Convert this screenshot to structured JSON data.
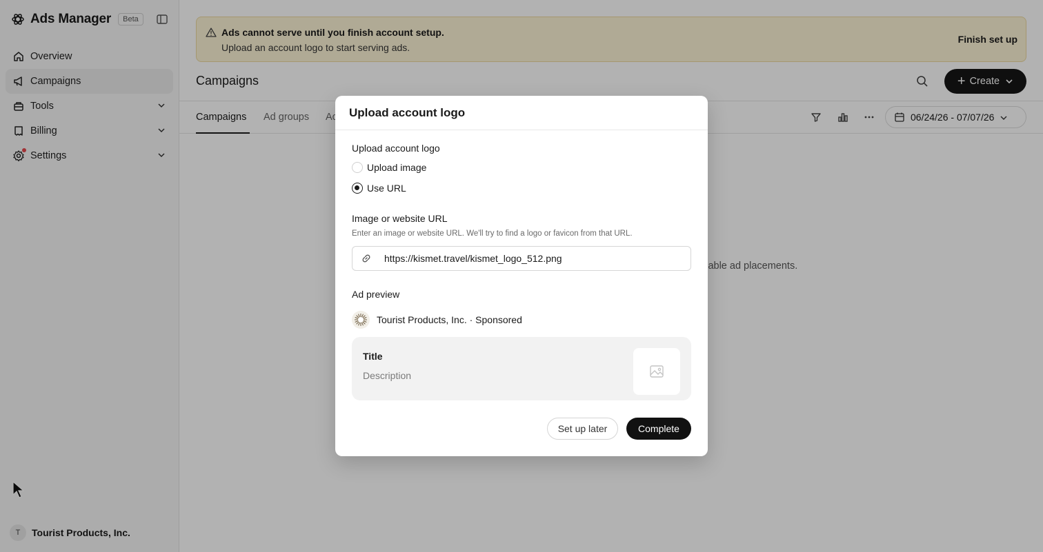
{
  "sidebar": {
    "app_title": "Ads Manager",
    "beta_label": "Beta",
    "items": [
      {
        "label": "Overview",
        "icon": "home-icon"
      },
      {
        "label": "Campaigns",
        "icon": "megaphone-icon",
        "active": true
      },
      {
        "label": "Tools",
        "icon": "tools-icon",
        "expandable": true
      },
      {
        "label": "Billing",
        "icon": "card-icon",
        "expandable": true
      },
      {
        "label": "Settings",
        "icon": "gear-icon",
        "expandable": true,
        "notification": true
      }
    ],
    "account": {
      "initial": "T",
      "name": "Tourist Products, Inc."
    }
  },
  "banner": {
    "title": "Ads cannot serve until you finish account setup.",
    "message": "Upload an account logo to start serving ads.",
    "action": "Finish set up"
  },
  "header": {
    "page_title": "Campaigns",
    "create_label": "Create"
  },
  "tabs": [
    {
      "label": "Campaigns",
      "active": true
    },
    {
      "label": "Ad groups"
    },
    {
      "label": "Ac"
    }
  ],
  "toolbar": {
    "date_range": "06/24/26 - 07/07/26"
  },
  "empty_state": {
    "text_fragment": "ilable ad placements."
  },
  "modal": {
    "title": "Upload account logo",
    "section_label": "Upload account logo",
    "options": [
      {
        "label": "Upload image",
        "selected": false
      },
      {
        "label": "Use URL",
        "selected": true
      }
    ],
    "url_label": "Image or website URL",
    "url_help": "Enter an image or website URL. We'll try to find a logo or favicon from that URL.",
    "url_value": "https://kismet.travel/kismet_logo_512.png",
    "preview_label": "Ad preview",
    "advertiser": "Tourist Products, Inc. · Sponsored",
    "ad_title": "Title",
    "ad_description": "Description",
    "secondary_button": "Set up later",
    "primary_button": "Complete"
  },
  "colors": {
    "banner_bg": "#fdf4d6",
    "primary": "#111111",
    "notification_dot": "#e5484d"
  }
}
